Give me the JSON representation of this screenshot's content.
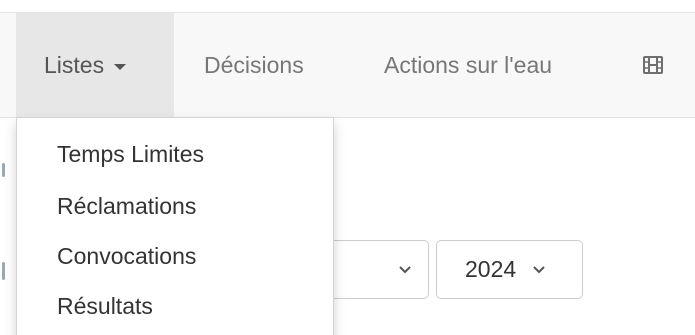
{
  "navbar": {
    "items": [
      {
        "label": "Listes",
        "active": true,
        "has_caret": true
      },
      {
        "label": "Décisions"
      },
      {
        "label": "Actions sur l'eau"
      }
    ],
    "icon_item": {
      "icon": "film-icon"
    }
  },
  "dropdown": {
    "items": [
      {
        "label": "Temps Limites"
      },
      {
        "label": "Réclamations"
      },
      {
        "label": "Convocations"
      },
      {
        "label": "Résultats"
      }
    ]
  },
  "filters": {
    "month_select": {
      "value": ""
    },
    "year_select": {
      "value": "2024"
    }
  },
  "colors": {
    "navbar_bg": "#f8f8f8",
    "active_item_bg": "#e7e7e7",
    "nav_text": "#777777",
    "menu_text": "#333333"
  }
}
